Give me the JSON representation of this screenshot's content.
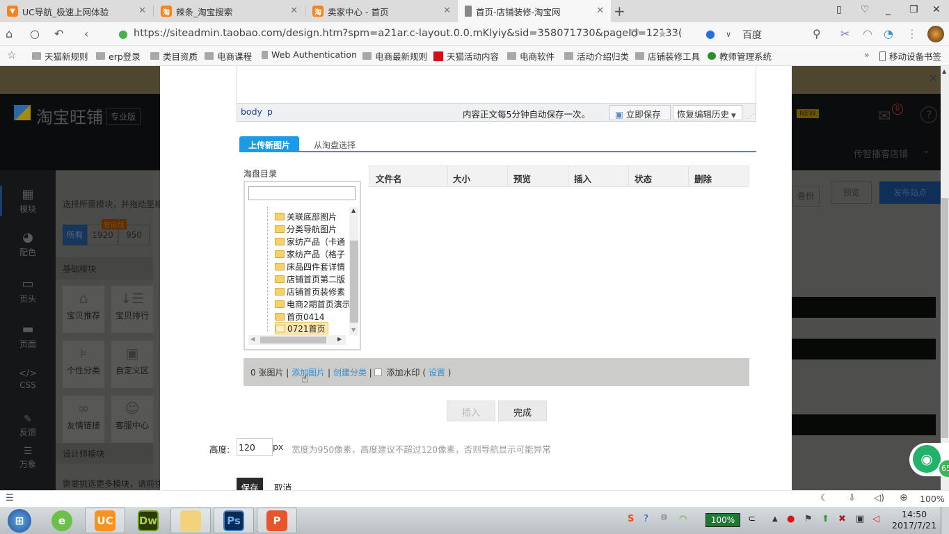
{
  "browser": {
    "tabs": [
      {
        "title": "UC导航_极速上网体验",
        "icon": "uc-icon",
        "icon_color": "#f58220",
        "active": false
      },
      {
        "title": "辣条_淘宝搜索",
        "icon": "taobao-icon",
        "icon_color": "#f5841f",
        "active": false
      },
      {
        "title": "卖家中心 - 首页",
        "icon": "taobao-icon",
        "icon_color": "#f5841f",
        "active": false
      },
      {
        "title": "首页-店铺装修-淘宝网",
        "icon": "page-icon",
        "icon_color": "#888888",
        "active": true
      }
    ],
    "new_tab_label": "+",
    "url": "https://siteadmin.taobao.com/design.htm?spm=a21ar.c-layout.0.0.mKlyiy&sid=358071730&pageId=12133(",
    "search_engine": "百度",
    "bookmarks": [
      {
        "label": "天猫新规则",
        "icon": "folder-icon"
      },
      {
        "label": "erp登录",
        "icon": "folder-icon"
      },
      {
        "label": "类目资质",
        "icon": "folder-icon"
      },
      {
        "label": "电商课程",
        "icon": "folder-icon"
      },
      {
        "label": "Web Authentication",
        "icon": "page-icon"
      },
      {
        "label": "电商最新规则",
        "icon": "folder-icon"
      },
      {
        "label": "天猫活动内容",
        "icon": "tmall-icon"
      },
      {
        "label": "电商软件",
        "icon": "folder-icon"
      },
      {
        "label": "活动介绍归类",
        "icon": "folder-icon"
      },
      {
        "label": "店铺装修工具",
        "icon": "folder-icon"
      },
      {
        "label": "教师管理系统",
        "icon": "leaf-icon"
      }
    ],
    "bookmarks_more": "»",
    "mobile_bookmarks": "移动设备书签",
    "zoom_level": "100%"
  },
  "background_page": {
    "logo": "淘宝旺铺",
    "edition": "专业版",
    "new_badge": "NEW",
    "mail_count": "0",
    "store_name": "传智播客店铺",
    "buttons": {
      "backup": "备份",
      "preview": "预览",
      "publish": "发布站点"
    },
    "left_nav": [
      {
        "label": "模块",
        "icon": "grid-icon",
        "glyph": "▦"
      },
      {
        "label": "配色",
        "icon": "palette-icon",
        "glyph": "◕"
      },
      {
        "label": "页头",
        "icon": "header-icon",
        "glyph": "▭"
      },
      {
        "label": "页面",
        "icon": "page-layout-icon",
        "glyph": "▬"
      },
      {
        "label": "CSS",
        "icon": "code-icon",
        "glyph": "</>"
      },
      {
        "label": "反馈",
        "icon": "feedback-icon",
        "glyph": "✎"
      },
      {
        "label": "万象",
        "icon": "message-icon",
        "glyph": "☰"
      }
    ],
    "hint": "选择所需模块，并拖动至相",
    "filters": [
      "所有",
      "1920",
      "950"
    ],
    "smart_badge": "智能版",
    "section_basic": "基础模块",
    "modules": [
      {
        "label": "宝贝推荐",
        "glyph": "⌂"
      },
      {
        "label": "宝贝排行",
        "glyph": "↓☰"
      },
      {
        "label": "个性分类",
        "glyph": "⊧"
      },
      {
        "label": "自定义区",
        "glyph": "▣"
      },
      {
        "label": "友情链接",
        "glyph": "∞"
      },
      {
        "label": "客服中心",
        "glyph": "☺"
      }
    ],
    "section_designer": "设计师模块",
    "designer_hint": "需要挑选更多模块，请前往"
  },
  "modal": {
    "editor_path": [
      "body",
      "p"
    ],
    "autosave_note": "内容正文每5分钟自动保存一次。",
    "save_now": "立即保存",
    "restore_history": "恢复编辑历史",
    "tabs": {
      "upload": "上传新图片",
      "from_pan": "从淘盘选择"
    },
    "directory": {
      "label": "淘盘目录",
      "search_value": "",
      "folders": [
        "关联底部图片",
        "分类导航图片",
        "家纺产品（卡通",
        "家纺产品（格子",
        "床品四件套详情",
        "店铺首页第二版",
        "店铺首页装修素",
        "电商2期首页演示",
        "首页0414",
        "0721首页"
      ],
      "selected": "0721首页"
    },
    "file_table": {
      "columns": [
        "文件名",
        "大小",
        "预览",
        "插入",
        "状态",
        "删除"
      ],
      "rows": []
    },
    "status": {
      "count": "0 张图片",
      "add_image": "添加图片",
      "create_category": "创建分类",
      "watermark_label": "添加水印",
      "watermark_checked": false,
      "settings": "设置"
    },
    "buttons": {
      "insert": "插入",
      "done": "完成"
    },
    "height": {
      "label": "高度:",
      "value": "120",
      "unit": "px",
      "hint": "宽度为950像素，高度建议不超过120像素，否则导航显示可能异常"
    },
    "save": "保存",
    "cancel": "取消"
  },
  "taskbar": {
    "apps": [
      {
        "name": "start-button"
      },
      {
        "name": "ie-browser"
      },
      {
        "name": "uc-browser"
      },
      {
        "name": "dreamweaver",
        "label": "Dw"
      },
      {
        "name": "file-explorer"
      },
      {
        "name": "photoshop",
        "label": "Ps"
      },
      {
        "name": "powerpoint"
      }
    ],
    "battery": "100%",
    "time": "14:50",
    "date": "2017/7/21",
    "speed_widget": "65"
  }
}
